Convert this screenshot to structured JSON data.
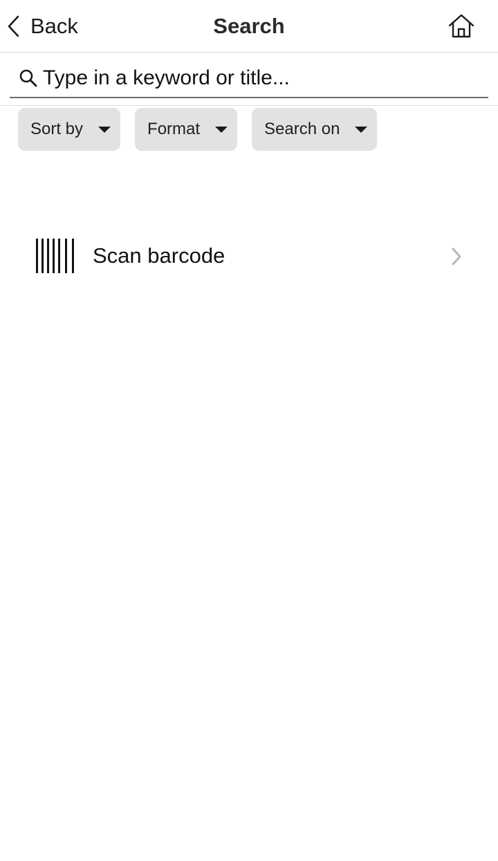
{
  "nav": {
    "back_label": "Back",
    "title": "Search",
    "home_icon": "home-icon"
  },
  "search": {
    "placeholder": "Type in a keyword or title...",
    "value": "",
    "icon": "search-icon"
  },
  "filters": [
    {
      "label": "Sort by"
    },
    {
      "label": "Format"
    },
    {
      "label": "Search on"
    }
  ],
  "scan": {
    "label": "Scan barcode",
    "icon": "barcode-icon"
  },
  "colors": {
    "chip_bg": "#e2e2e2",
    "divider": "#dcdcdc",
    "chevron": "#b5b5b5"
  }
}
